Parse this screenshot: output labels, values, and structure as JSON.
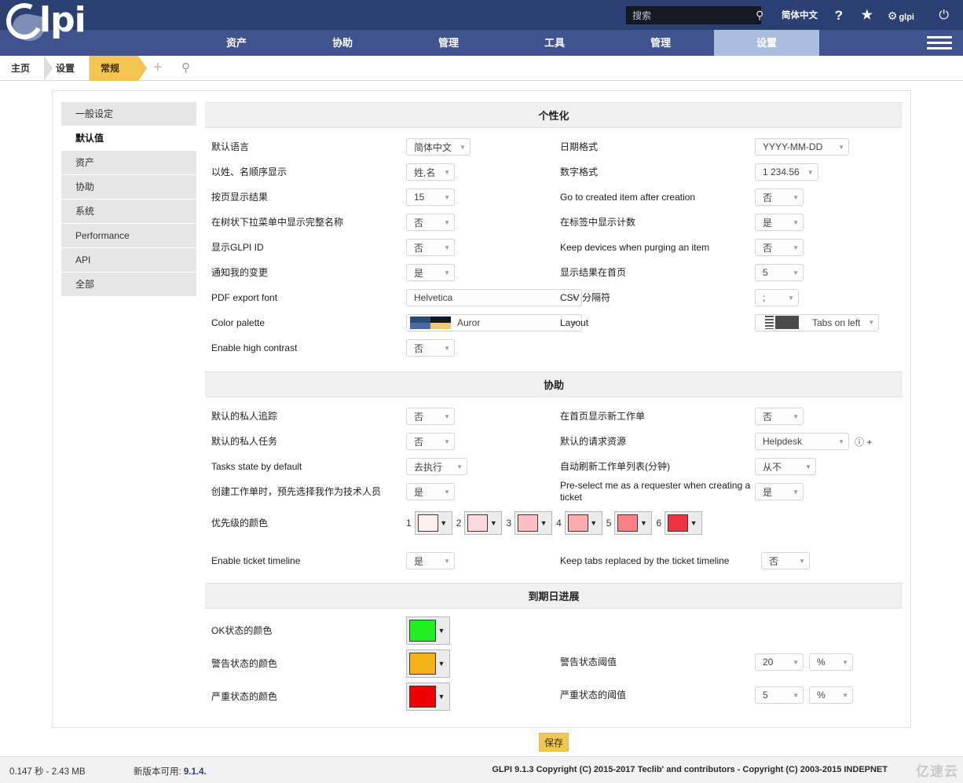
{
  "header": {
    "logo_text": "lpi",
    "search_placeholder": "搜索",
    "search_value": "",
    "language": "简体中文",
    "help_icon": "?",
    "star_icon": "★",
    "gear_icon": "⚙",
    "user": "glpi",
    "power_icon": "⏻"
  },
  "mainnav": {
    "tabs": [
      {
        "label": "资产",
        "active": false
      },
      {
        "label": "协助",
        "active": false
      },
      {
        "label": "管理",
        "active": false
      },
      {
        "label": "工具",
        "active": false
      },
      {
        "label": "管理",
        "active": false
      },
      {
        "label": "设置",
        "active": true
      }
    ]
  },
  "breadcrumb": {
    "items": [
      {
        "label": "主页",
        "current": false
      },
      {
        "label": "设置",
        "current": false
      },
      {
        "label": "常规",
        "current": true
      }
    ],
    "add_icon": "+",
    "search_icon": "⌕"
  },
  "sidebar": {
    "items": [
      {
        "label": "一般设定",
        "active": false
      },
      {
        "label": "默认值",
        "active": true
      },
      {
        "label": "资产",
        "active": false
      },
      {
        "label": "协助",
        "active": false
      },
      {
        "label": "系统",
        "active": false
      },
      {
        "label": "Performance",
        "active": false
      },
      {
        "label": "API",
        "active": false
      },
      {
        "label": "全部",
        "active": false
      }
    ]
  },
  "sections": {
    "personalization": {
      "title": "个性化",
      "fields": {
        "default_language": {
          "label": "默认语言",
          "value": "简体中文"
        },
        "surname_firstname_order": {
          "label": "以姓、名顺序显示",
          "value": "姓,名"
        },
        "results_per_page": {
          "label": "按页显示结果",
          "value": "15"
        },
        "full_name_dropdown": {
          "label": "在树状下拉菜单中显示完整名称",
          "value": "否"
        },
        "display_glpi_id": {
          "label": "显示GLPI ID",
          "value": "否"
        },
        "notify_my_changes": {
          "label": "通知我的变更",
          "value": "是"
        },
        "pdf_export_font": {
          "label": "PDF export font",
          "value": "Helvetica"
        },
        "color_palette": {
          "label": "Color palette",
          "value": "Auror"
        },
        "enable_high_contrast": {
          "label": "Enable high contrast",
          "value": "否"
        },
        "date_format": {
          "label": "日期格式",
          "value": "YYYY-MM-DD"
        },
        "number_format": {
          "label": "数字格式",
          "value": "1 234.56"
        },
        "goto_created_item": {
          "label": "Go to created item after creation",
          "value": "否"
        },
        "show_count_on_tabs": {
          "label": "在标签中显示计数",
          "value": "是"
        },
        "keep_devices_on_purge": {
          "label": "Keep devices when purging an item",
          "value": "否"
        },
        "results_on_home": {
          "label": "显示结果在首页",
          "value": "5"
        },
        "csv_delimiter": {
          "label": "CSV 分隔符",
          "value": ";"
        },
        "layout": {
          "label": "Layout",
          "value": "Tabs on left"
        }
      },
      "palette_colors": [
        "#2f4878",
        "#12182c",
        "#4a6aa5",
        "#f5c970"
      ]
    },
    "assistance": {
      "title": "协助",
      "fields": {
        "default_private_followup": {
          "label": "默认的私人追踪",
          "value": "否"
        },
        "default_private_task": {
          "label": "默认的私人任务",
          "value": "否"
        },
        "tasks_state_default": {
          "label": "Tasks state by default",
          "value": "去执行"
        },
        "preselect_technician": {
          "label": "创建工作单时，预先选择我作为技术人员",
          "value": "是"
        },
        "show_new_ticket_home": {
          "label": "在首页显示新工作单",
          "value": "否"
        },
        "default_request_source": {
          "label": "默认的请求资源",
          "value": "Helpdesk",
          "suffix": "ⓘ +"
        },
        "auto_refresh_ticket_list": {
          "label": "自动刷新工作单列表(分钟)",
          "value": "从不"
        },
        "preselect_requester": {
          "label": "Pre-select me as a requester when creating a ticket",
          "value": "是"
        },
        "priority_colors": {
          "label": "优先级的颜色"
        },
        "enable_ticket_timeline": {
          "label": "Enable ticket timeline",
          "value": "是"
        },
        "keep_tabs_timeline": {
          "label": "Keep tabs replaced by the ticket timeline",
          "value": "否"
        }
      },
      "priorities": [
        {
          "num": "1",
          "color": "#fdeef0"
        },
        {
          "num": "2",
          "color": "#fbd9de"
        },
        {
          "num": "3",
          "color": "#fbbfc4"
        },
        {
          "num": "4",
          "color": "#fbabb0"
        },
        {
          "num": "5",
          "color": "#fb8185"
        },
        {
          "num": "6",
          "color": "#ef3340"
        }
      ]
    },
    "duedate": {
      "title": "到期日进展",
      "fields": {
        "ok_color": {
          "label": "OK状态的颜色",
          "color": "#22ee22"
        },
        "warn_color": {
          "label": "警告状态的颜色",
          "color": "#f5b218"
        },
        "crit_color": {
          "label": "严重状态的颜色",
          "color": "#ee0000"
        },
        "warn_threshold": {
          "label": "警告状态阈值",
          "value": "20",
          "unit": "%"
        },
        "crit_threshold": {
          "label": "严重状态的阈值",
          "value": "5",
          "unit": "%"
        }
      }
    }
  },
  "actions": {
    "save_label": "保存"
  },
  "footer": {
    "perf": "0.147 秒 - 2.43 MB",
    "new_version_label": "新版本可用:",
    "new_version": "9.1.4.",
    "copyright": "GLPI 9.1.3 Copyright (C) 2015-2017 Teclib' and contributors - Copyright (C) 2003-2015 INDEPNET",
    "watermark": "亿速云"
  }
}
